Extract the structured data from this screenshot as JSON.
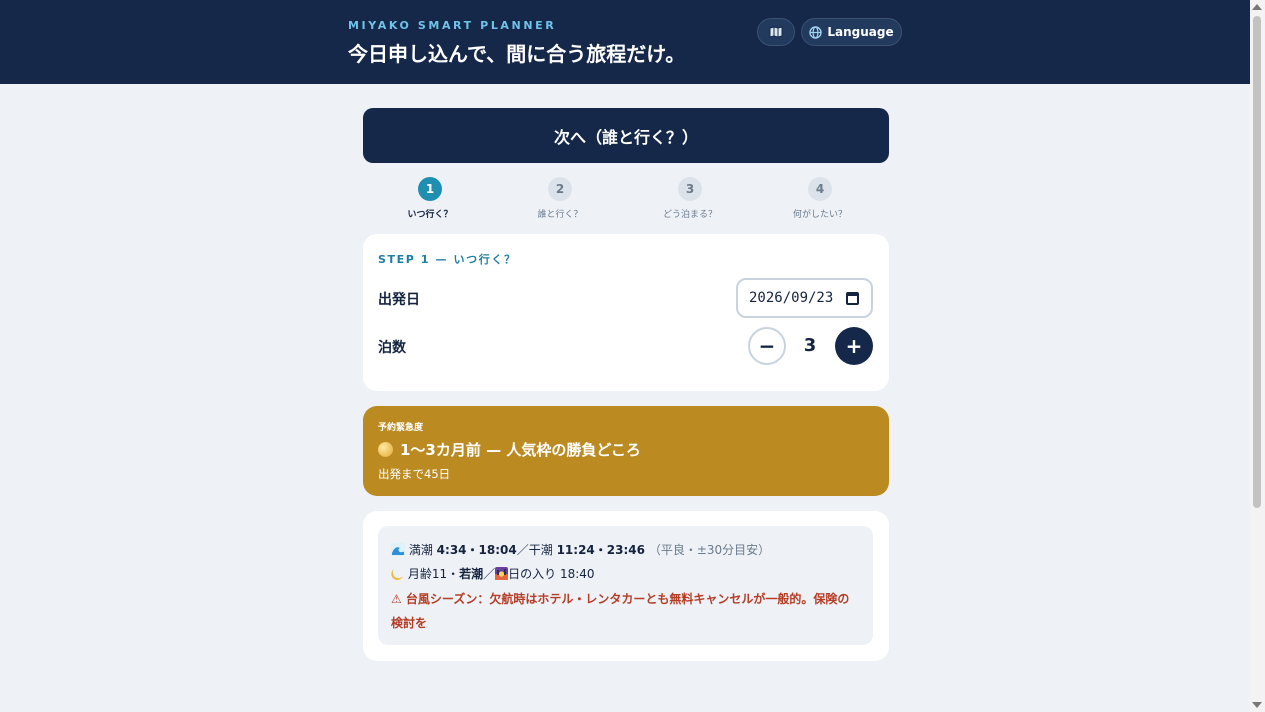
{
  "header": {
    "brand": "MIYAKO SMART PLANNER",
    "tagline": "今日申し込んで、間に合う旅程だけ。",
    "map_icon": "map-icon",
    "language_icon": "globe-icon",
    "language_label": "Language"
  },
  "next_button": "次へ（誰と行く？）",
  "steps": [
    {
      "num": "1",
      "label": "いつ行く？",
      "active": true
    },
    {
      "num": "2",
      "label": "誰と行く？",
      "active": false
    },
    {
      "num": "3",
      "label": "どう泊まる？",
      "active": false
    },
    {
      "num": "4",
      "label": "何がしたい？",
      "active": false
    }
  ],
  "step1": {
    "title": "STEP 1 — いつ行く？",
    "departure_label": "出発日",
    "departure_value": "2026/09/23",
    "nights_label": "泊数",
    "nights_value": "3",
    "minus": "−",
    "plus": "+"
  },
  "urgency": {
    "tag": "予約緊急度",
    "title": "1〜3カ月前 — 人気枠の勝負どころ",
    "subtitle": "出発まで45日",
    "color": "#bb8b22"
  },
  "conditions": {
    "tide_icon": "wave-icon",
    "high_tide_label": "満潮",
    "high_tide": "4:34・18:04",
    "low_tide_label": "干潮",
    "low_tide": "11:24・23:46",
    "tide_note": "（平良・±30分目安）",
    "moon_icon": "crescent-moon-icon",
    "moon_age_label": "月齢11・",
    "moon_phase": "若潮",
    "sunset_icon": "sunset-icon",
    "sunset": "日の入り 18:40",
    "warning": "⚠ 台風シーズン：欠航時はホテル・レンタカーとも無料キャンセルが一般的。保険の検討を"
  }
}
